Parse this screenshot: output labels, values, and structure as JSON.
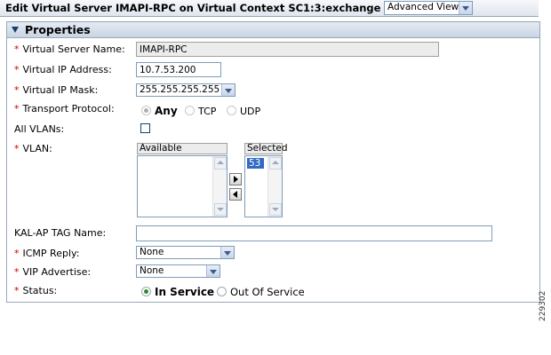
{
  "window": {
    "title": "Edit Virtual Server IMAPI-RPC on Virtual Context SC1:3:exchange",
    "view_select": "Advanced View"
  },
  "section": {
    "title": "Properties"
  },
  "required_mark": "*",
  "fields": {
    "virtual_server_name": {
      "label": "Virtual Server Name:",
      "value": "IMAPI-RPC"
    },
    "virtual_ip_address": {
      "label": "Virtual IP Address:",
      "value": "10.7.53.200"
    },
    "virtual_ip_mask": {
      "label": "Virtual IP Mask:",
      "value": "255.255.255.255"
    },
    "transport_protocol": {
      "label": "Transport Protocol:",
      "options": [
        "Any",
        "TCP",
        "UDP"
      ],
      "selected": "Any"
    },
    "all_vlans": {
      "label": "All VLANs:",
      "checked": false
    },
    "vlan": {
      "label": "VLAN:",
      "available_header": "Available",
      "selected_header": "Selected",
      "available_items": [],
      "selected_items": [
        "53"
      ]
    },
    "kal_ap_tag_name": {
      "label": "KAL-AP TAG Name:",
      "value": ""
    },
    "icmp_reply": {
      "label": "ICMP Reply:",
      "value": "None"
    },
    "vip_advertise": {
      "label": "VIP Advertise:",
      "value": "None"
    },
    "status": {
      "label": "Status:",
      "options": [
        "In Service",
        "Out Of Service"
      ],
      "selected": "In Service"
    }
  },
  "figure_number": "229302"
}
